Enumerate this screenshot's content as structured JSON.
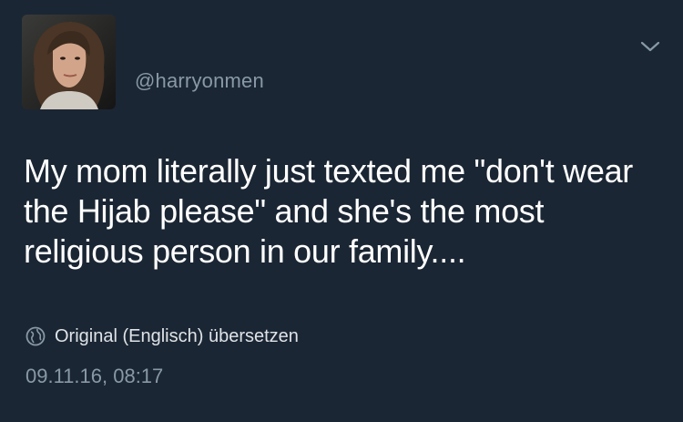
{
  "tweet": {
    "handle": "@harryonmen",
    "text": "My mom literally just texted me \"don't wear the Hijab please\" and she's the most religious person in our family....",
    "translate_label": "Original (Englisch) übersetzen",
    "timestamp": "09.11.16, 08:17"
  },
  "icons": {
    "avatar": "profile-photo",
    "menu": "chevron-down-icon",
    "translate": "globe-icon"
  },
  "colors": {
    "background": "#1b2634",
    "text_primary": "#ffffff",
    "text_secondary": "#8899a6"
  }
}
